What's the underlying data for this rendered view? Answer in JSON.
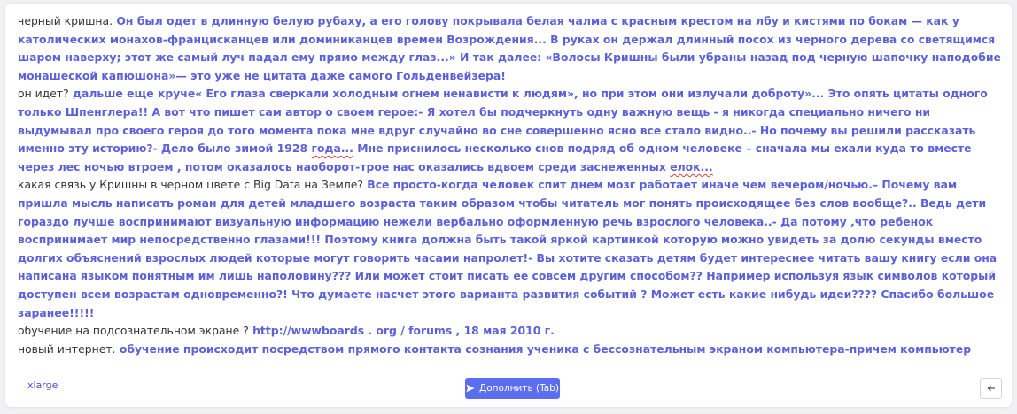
{
  "editor": {
    "paragraphs": [
      {
        "prompt": "черный кришна.",
        "generated_segments": [
          " Он был одет в длинную белую рубаху, а его голову покрывала белая чалма с красным крестом на лбу и кистями по бокам — как у католических монахов-францисканцев или доминиканцев времен Возрождения... В руках он держал длинный посох из черного дерева со светящимся шаром наверху; этот же самый луч падал ему прямо между глаз...» И так далее: «Волосы Кришны были убраны назад под черную шапочку наподобие монашеской капюшона»— это уже не цитата даже самого Гольденвейзера!"
        ]
      },
      {
        "prompt": "он идет?",
        "generated_segments": [
          " дальше еще круче« Его глаза сверкали холодным огнем ненависти к людям», но при этом они излучали доброту»... Это опять цитаты одного только Шпенглера!! А вот что пишет сам автор о своем герое:- Я хотел бы подчеркнуть одну важную вещь - я никогда специально ничего ни выдумывал про своего героя до того момента пока мне вдруг случайно во сне совершенно ясно все стало видно..- Но почему вы решили рассказать именно эту историю?- Дело было зимой 1928 ",
          "года...",
          " Мне приснилось несколько снов подряд об одном человеке – сначала мы ехали куда то вместе через лес ночью втроем , потом оказалось наоборот-трое нас оказались вдвоем среди заснеженных ",
          "елок...",
          ""
        ]
      },
      {
        "prompt": "какая связь у Кришны в черном цвете с Big Data на Земле?",
        "generated_segments": [
          "  Все просто-когда человек спит днем мозг работает иначе чем вечером/ночью.– Почему вам пришла мысль написать роман для детей младшего возраста таким образом чтобы читатель мог понять происходящее без слов вообще?.. Ведь дети гораздо лучше воспринимают визуальную информацию нежели вербально оформленную речь взрослого человека..- Да потому ,что ребенок воспринимает мир непосредственно глазами!!! Поэтому книга должна быть такой яркой картинкой которую можно увидеть за долю секунды вместо долгих объяснений взрослых людей которые могут говорить часами напролет!- Вы хотите сказать детям будет интереснее читать вашу книгу если она написана языком понятным им лишь наполовину??? Или может стоит писать ее совсем другим способом?? Например используя язык символов который доступен всем возрастам одновременно?! Что думаете насчет этого варианта развития событий ? Может есть какие нибудь идеи???? Спасибо большое заранее!!!!!"
        ]
      },
      {
        "prompt": "обучение на  подсознательном экране  ?",
        "generated_segments": [
          " http://wwwboards . org / forums , 18 мая 2010 г."
        ]
      },
      {
        "prompt": "новый интернет.",
        "generated_segments": [
          " обучение происходит посредством прямого контакта сознания ученика с бессознательным экраном компьютера-причем компьютер выступает здесь скорее проводником информации от учителя ученику ,чем источником знаний ."
        ]
      }
    ]
  },
  "footer": {
    "model_size": "xlarge",
    "complete_label": "Дополнить (Tab)",
    "complete_icon": "send-icon",
    "back_icon": "arrow-left-icon"
  },
  "colors": {
    "generated_text": "#5b61d8",
    "button_bg": "#5b6ef0",
    "spell_underline": "#e03a3a"
  }
}
